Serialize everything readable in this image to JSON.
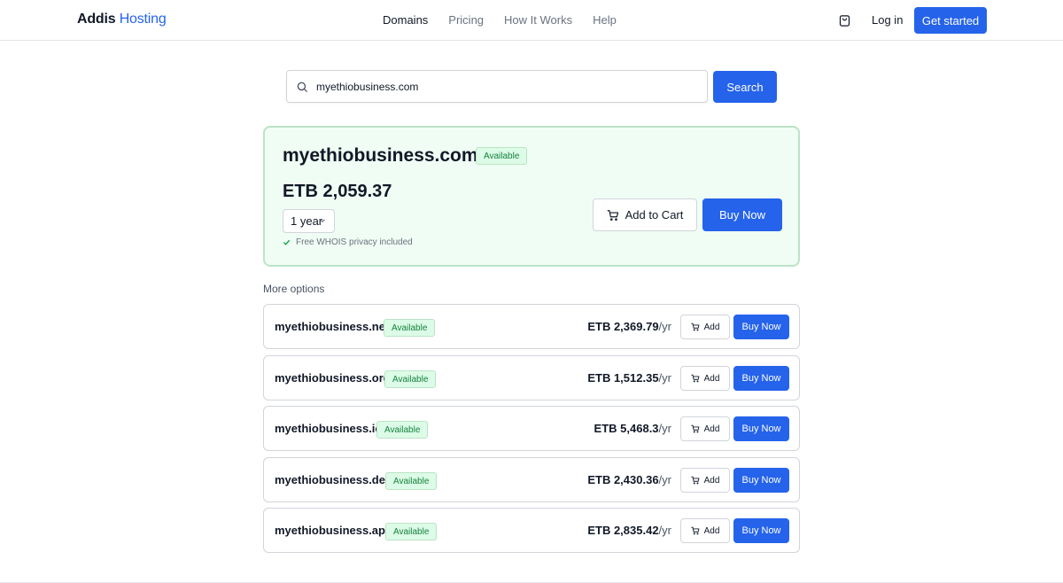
{
  "header": {
    "logo_primary": "Addis",
    "logo_accent": "Hosting",
    "nav": [
      {
        "label": "Domains",
        "active": true
      },
      {
        "label": "Pricing",
        "active": false
      },
      {
        "label": "How It Works",
        "active": false
      },
      {
        "label": "Help",
        "active": false
      }
    ],
    "cart_icon": "shopping-bag-icon",
    "login_label": "Log in",
    "cta_label": "Get started"
  },
  "search": {
    "value": "myethiobusiness.com",
    "button_label": "Search",
    "icon": "search-icon"
  },
  "featured": {
    "domain": "myethiobusiness.com",
    "status": "Available",
    "price": "ETB 2,059.37",
    "term": "1 year",
    "note": "Free WHOIS privacy included",
    "add_to_cart_label": "Add to Cart",
    "buy_now_label": "Buy Now"
  },
  "more_options": {
    "title": "More options",
    "items": [
      {
        "domain": "myethiobusiness.net",
        "status": "Available",
        "price": "ETB 2,369.79",
        "per": "/yr",
        "add_label": "Add",
        "buy_label": "Buy Now"
      },
      {
        "domain": "myethiobusiness.org",
        "status": "Available",
        "price": "ETB 1,512.35",
        "per": "/yr",
        "add_label": "Add",
        "buy_label": "Buy Now"
      },
      {
        "domain": "myethiobusiness.io",
        "status": "Available",
        "price": "ETB 5,468.3",
        "per": "/yr",
        "add_label": "Add",
        "buy_label": "Buy Now"
      },
      {
        "domain": "myethiobusiness.dev",
        "status": "Available",
        "price": "ETB 2,430.36",
        "per": "/yr",
        "add_label": "Add",
        "buy_label": "Buy Now"
      },
      {
        "domain": "myethiobusiness.app",
        "status": "Available",
        "price": "ETB 2,835.42",
        "per": "/yr",
        "add_label": "Add",
        "buy_label": "Buy Now"
      }
    ]
  },
  "colors": {
    "primary": "#2563eb",
    "available_bg": "#dcfce7",
    "available_text": "#15803d",
    "featured_bg": "#f0fdf4",
    "featured_border": "#bbe3c7"
  }
}
